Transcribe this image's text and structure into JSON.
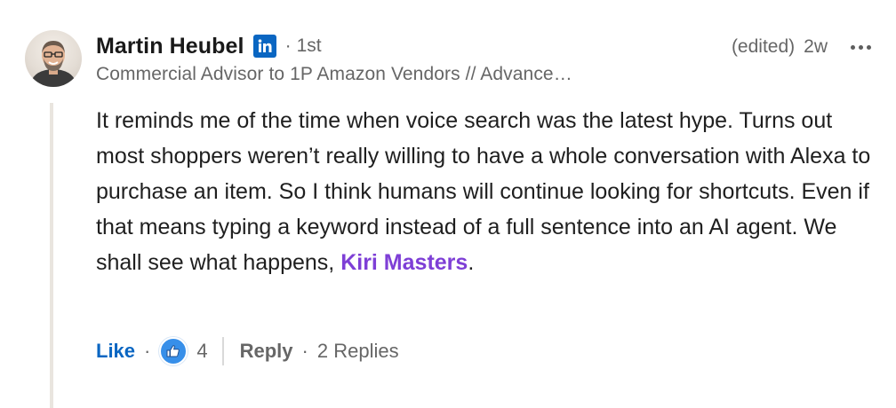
{
  "comment": {
    "author": {
      "name": "Martin Heubel",
      "badge_icon": "linkedin-icon",
      "degree": "1st",
      "headline": "Commercial Advisor to 1P Amazon Vendors // Advance…"
    },
    "edited_label": "(edited)",
    "time_ago": "2w",
    "more_icon": "ellipsis-icon",
    "body": {
      "text": "It reminds me of the time when voice search was the latest hype. Turns out most shoppers weren’t really willing to have a whole conversation with Alexa to purchase an item. So I think humans will continue looking for shortcuts. Even if that means typing a keyword instead of a full sentence into an AI agent. We shall see what happens, ",
      "mention": "Kiri Masters",
      "trailing": "."
    },
    "actions": {
      "like_label": "Like",
      "reaction_icon": "thumbs-up-icon",
      "reaction_count": "4",
      "reply_label": "Reply",
      "replies_label": "2 Replies"
    }
  },
  "colors": {
    "link_blue": "#0a66c2",
    "mention_purple": "#7e3fd6",
    "meta_gray": "#666666"
  }
}
